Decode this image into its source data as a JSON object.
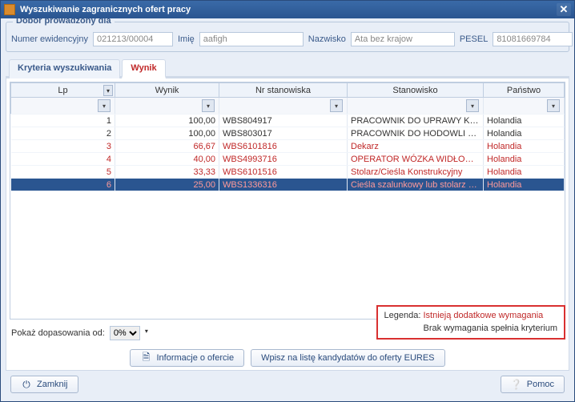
{
  "window": {
    "title": "Wyszukiwanie zagranicznych ofert pracy"
  },
  "dobor": {
    "legend": "Dobór prowadzony dla",
    "numer_label": "Numer ewidencyjny",
    "numer_value": "021213/00004",
    "imie_label": "Imię",
    "imie_value": "aafigh",
    "nazwisko_label": "Nazwisko",
    "nazwisko_value": "Ata bez krajow",
    "pesel_label": "PESEL",
    "pesel_value": "81081669784"
  },
  "tabs": {
    "t1": "Kryteria wyszukiwania",
    "t2": "Wynik"
  },
  "grid": {
    "headers": {
      "lp": "Lp",
      "wynik": "Wynik",
      "nr": "Nr stanowiska",
      "stan": "Stanowisko",
      "panstwo": "Państwo"
    },
    "rows": [
      {
        "lp": "1",
        "wynik": "100,00",
        "nr": "WBS804917",
        "stan": "PRACOWNIK DO UPRAWY KWIATÓW",
        "panstwo": "Holandia",
        "red": false,
        "sel": false
      },
      {
        "lp": "2",
        "wynik": "100,00",
        "nr": "WBS803017",
        "stan": "PRACOWNIK DO HODOWLI PIECZA...",
        "panstwo": "Holandia",
        "red": false,
        "sel": false
      },
      {
        "lp": "3",
        "wynik": "66,67",
        "nr": "WBS6101816",
        "stan": "Dekarz",
        "panstwo": "Holandia",
        "red": true,
        "sel": false
      },
      {
        "lp": "4",
        "wynik": "40,00",
        "nr": "WBS4993716",
        "stan": "OPERATOR WÓZKA WIDŁOWEGO",
        "panstwo": "Holandia",
        "red": true,
        "sel": false
      },
      {
        "lp": "5",
        "wynik": "33,33",
        "nr": "WBS6101516",
        "stan": "Stolarz/Cieśla Konstrukcyjny",
        "panstwo": "Holandia",
        "red": true,
        "sel": false
      },
      {
        "lp": "6",
        "wynik": "25,00",
        "nr": "WBS1336316",
        "stan": "Cieśla szalunkowy lub stolarz beton...",
        "panstwo": "Holandia",
        "red": true,
        "sel": true
      }
    ]
  },
  "match": {
    "label": "Pokaż dopasowania od:",
    "value": "0%"
  },
  "legenda": {
    "label": "Legenda:",
    "l1": "Istnieją dodatkowe wymagania",
    "l2": "Brak wymagania spełnia kryterium"
  },
  "buttons": {
    "info": "Informacje o ofercie",
    "wpisz": "Wpisz na listę kandydatów do oferty EURES",
    "zamknij": "Zamknij",
    "pomoc": "Pomoc"
  }
}
